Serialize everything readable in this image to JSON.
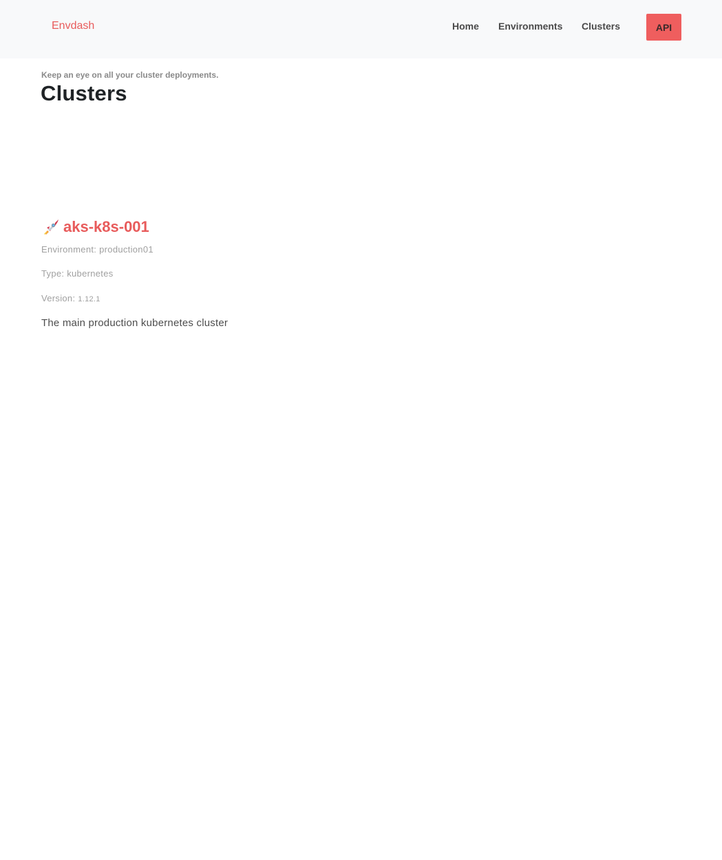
{
  "navbar": {
    "brand": "Envdash",
    "links": [
      {
        "label": "Home"
      },
      {
        "label": "Environments"
      },
      {
        "label": "Clusters"
      }
    ],
    "api_button": "API",
    "accent_color": "#ef5e5e"
  },
  "header": {
    "subtitle": "Keep an eye on all your cluster deployments.",
    "title": "Clusters"
  },
  "clusters": [
    {
      "icon": "rocket-icon",
      "name": "aks-k8s-001",
      "environment_label": "Environment:",
      "environment": "production01",
      "type_label": "Type:",
      "type": "kubernetes",
      "version_label": "Version:",
      "version": "1.12.1",
      "description": "The main production kubernetes cluster"
    }
  ]
}
